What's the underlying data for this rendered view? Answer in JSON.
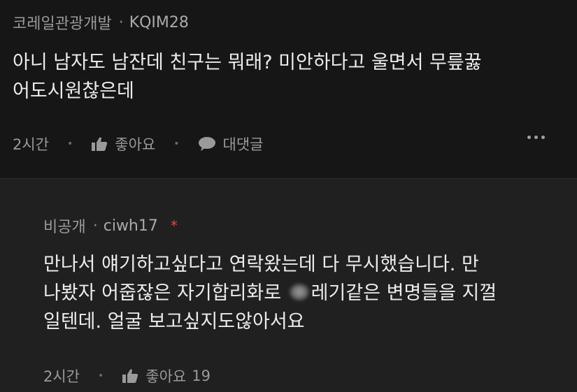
{
  "comments": [
    {
      "author": "코레일관광개발",
      "separator": "·",
      "username": "KQIM28",
      "lines": [
        "아니 남자도 남잔데 친구는 뭐래? 미안하다고 울면서 무릎꿇",
        "어도시원찮은데"
      ],
      "time": "2시간",
      "like_label": "좋아요",
      "reply_label": "대댓글"
    },
    {
      "author": "비공개",
      "separator": "·",
      "username": "ciwh17",
      "badge": "*",
      "lines": [
        "만나서 얘기하고싶다고 연락왔는데 다 무시했습니다. 만",
        "레기같은 변명들을 지껄",
        "일텐데. 얼굴 보고싶지도않아서요"
      ],
      "line2_prefix": "나봤자 어줍잖은 자기합리화로 ",
      "time": "2시간",
      "like_label": "좋아요",
      "like_count": "19"
    }
  ],
  "icons": {
    "like": "thumbs-up-icon",
    "reply": "speech-bubble-icon",
    "more": "more-dots-icon"
  },
  "colors": {
    "background_top": "#161616",
    "background_reply": "#202020",
    "text": "#ececec",
    "meta": "#9a9a9a",
    "badge": "#e0463c"
  }
}
